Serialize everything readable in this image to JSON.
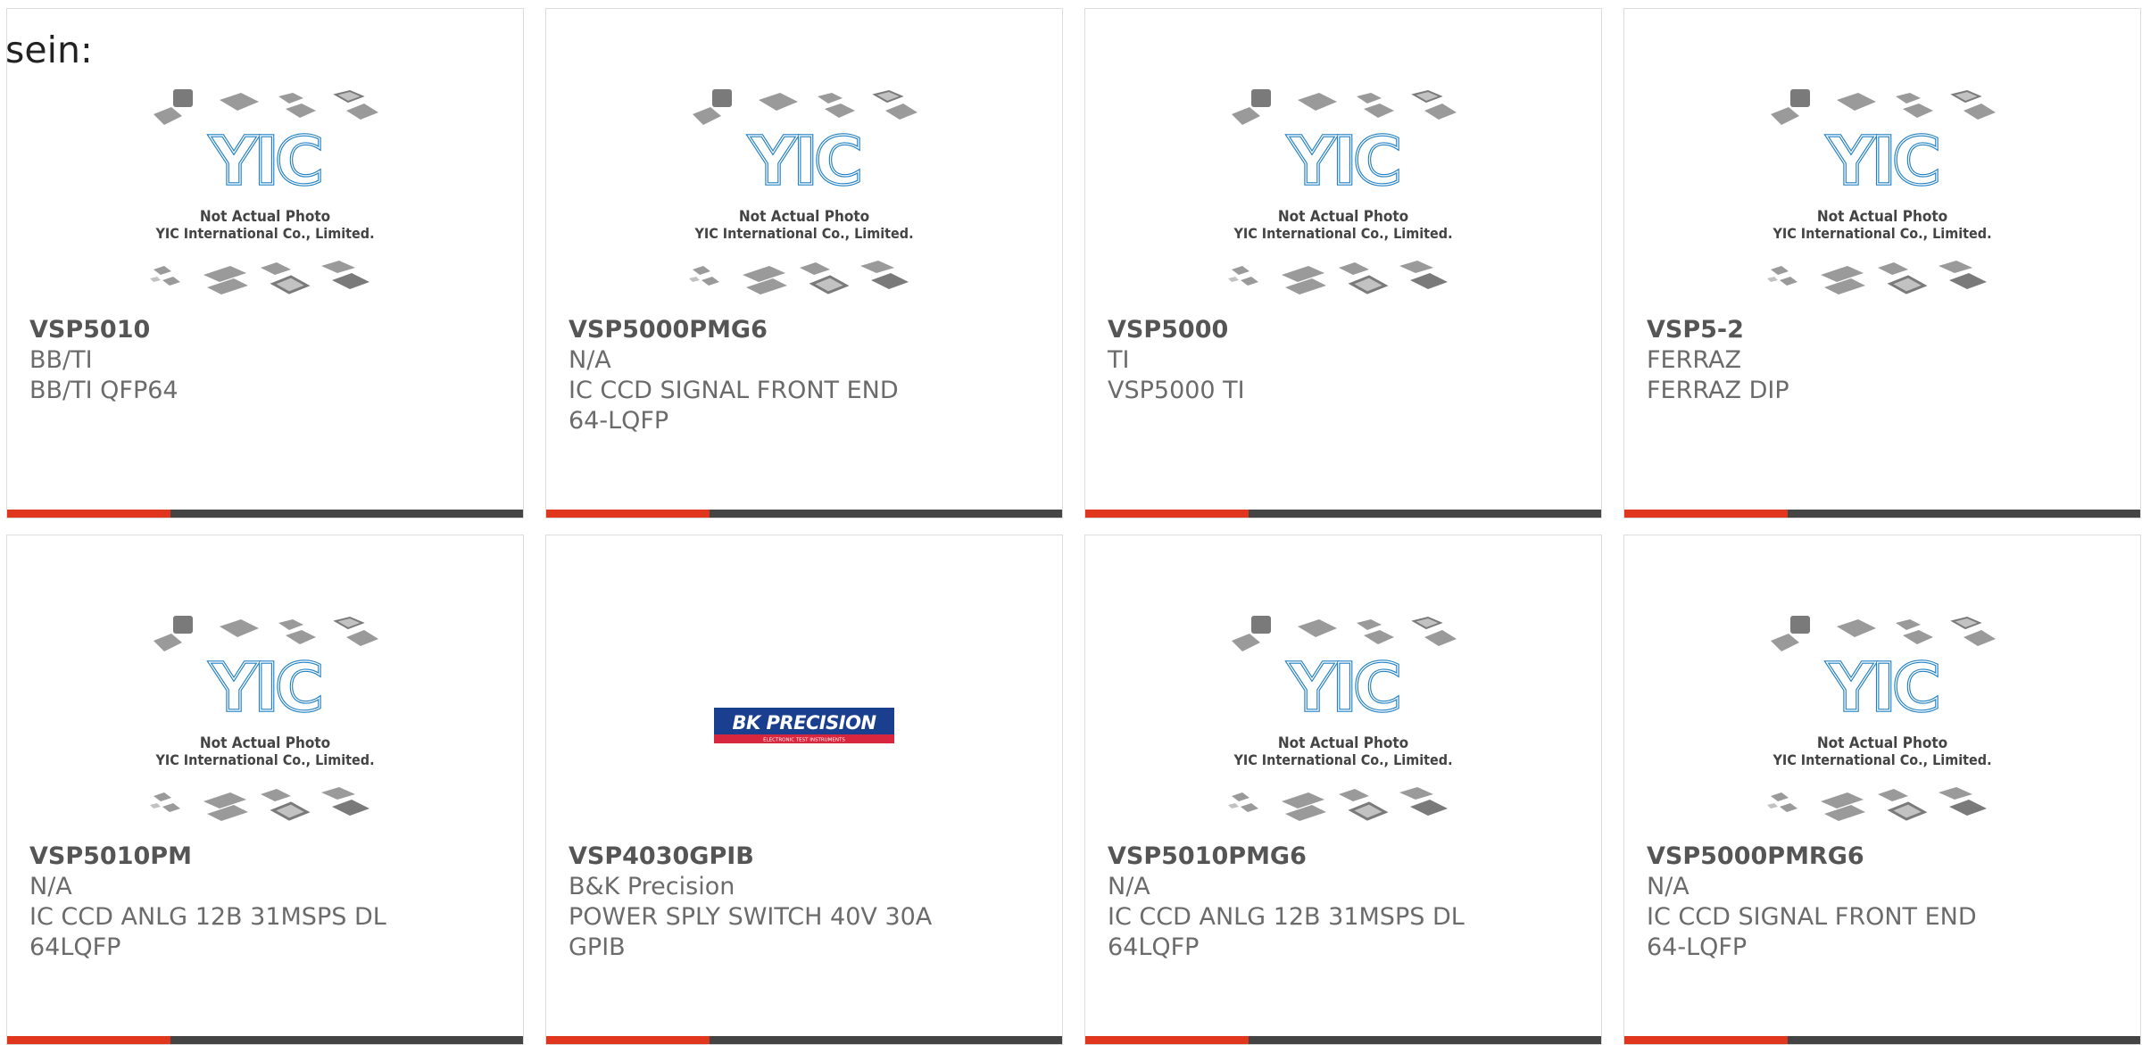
{
  "intro_text": "sein:",
  "placeholder_photo": {
    "logo_text": "YIC",
    "line1": "Not Actual Photo",
    "line2": "YIC International Co., Limited."
  },
  "bk_logo": {
    "brand": "BK PRECISION",
    "tagline": "ELECTRONIC TEST INSTRUMENTS"
  },
  "colors": {
    "accent": "#e0361e",
    "bar": "#444444",
    "yic_blue": "#1f7fc4",
    "bk_blue": "#1a3f8f",
    "bk_red": "#d7263d"
  },
  "products": [
    {
      "part_number": "VSP5010",
      "manufacturer": "BB/TI",
      "description": "BB/TI QFP64",
      "image": "yic-placeholder"
    },
    {
      "part_number": "VSP5000PMG6",
      "manufacturer": "N/A",
      "description": "IC CCD SIGNAL FRONT END 64-LQFP",
      "image": "yic-placeholder"
    },
    {
      "part_number": "VSP5000",
      "manufacturer": "TI",
      "description": "VSP5000 TI",
      "image": "yic-placeholder"
    },
    {
      "part_number": "VSP5-2",
      "manufacturer": "FERRAZ",
      "description": "FERRAZ DIP",
      "image": "yic-placeholder"
    },
    {
      "part_number": "VSP5010PM",
      "manufacturer": "N/A",
      "description": "IC CCD ANLG 12B 31MSPS DL 64LQFP",
      "image": "yic-placeholder"
    },
    {
      "part_number": "VSP4030GPIB",
      "manufacturer": "B&K Precision",
      "description": "POWER SPLY SWITCH 40V 30A GPIB",
      "image": "bk-precision-logo"
    },
    {
      "part_number": "VSP5010PMG6",
      "manufacturer": "N/A",
      "description": "IC CCD ANLG 12B 31MSPS DL 64LQFP",
      "image": "yic-placeholder"
    },
    {
      "part_number": "VSP5000PMRG6",
      "manufacturer": "N/A",
      "description": "IC CCD SIGNAL FRONT END 64-LQFP",
      "image": "yic-placeholder"
    }
  ]
}
